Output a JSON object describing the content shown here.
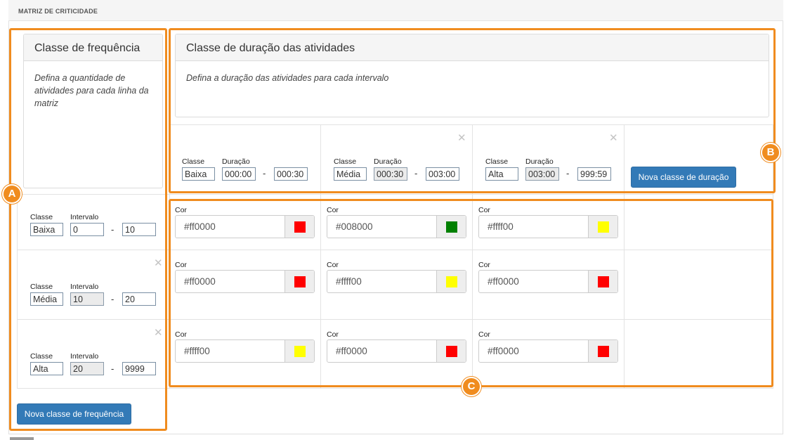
{
  "page": {
    "title": "MATRIZ DE CRITICIDADE"
  },
  "frequency": {
    "title": "Classe de frequência",
    "description": "Defina a quantidade de atividades para cada linha da matriz",
    "label_class": "Classe",
    "label_interval": "Intervalo",
    "rows": [
      {
        "name": "Baixa",
        "min": "0",
        "max": "10"
      },
      {
        "name": "Média",
        "min": "10",
        "max": "20"
      },
      {
        "name": "Alta",
        "min": "20",
        "max": "9999"
      }
    ],
    "add_button": "Nova classe de frequência"
  },
  "duration": {
    "title": "Classe de duração das atividades",
    "description": "Defina a duração das atividades para cada intervalo",
    "label_class": "Classe",
    "label_duration": "Duração",
    "columns": [
      {
        "name": "Baixa",
        "start": "000:00",
        "end": "000:30"
      },
      {
        "name": "Média",
        "start": "000:30",
        "end": "003:00"
      },
      {
        "name": "Alta",
        "start": "003:00",
        "end": "999:59"
      }
    ],
    "add_button": "Nova classe de duração"
  },
  "matrix": {
    "color_label": "Cor",
    "rows": [
      [
        "#ff0000",
        "#008000",
        "#ffff00"
      ],
      [
        "#ff0000",
        "#ffff00",
        "#ff0000"
      ],
      [
        "#ffff00",
        "#ff0000",
        "#ff0000"
      ]
    ]
  },
  "callouts": {
    "a": "A",
    "b": "B",
    "c": "C"
  },
  "colors": {
    "accent": "#f08c1f",
    "primary": "#337ab7"
  },
  "icons": {
    "remove": "close-icon"
  }
}
